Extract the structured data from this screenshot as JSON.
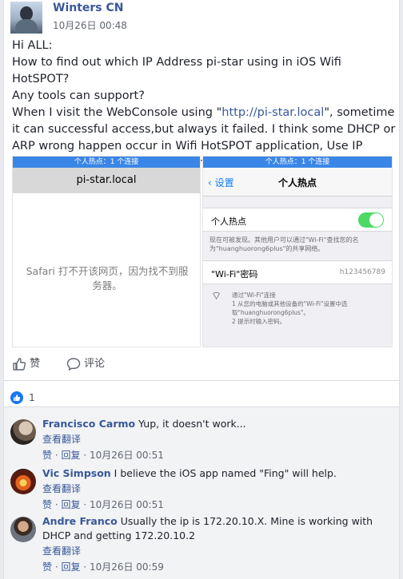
{
  "post": {
    "author": "Winters CN",
    "timestamp": "10月26日 00:48",
    "text_lines": [
      "Hi ALL:",
      "How to find out which IP Address pi-star using in iOS Wifi HotSPOT?",
      "Any tools can support?",
      "When I visit the WebConsole using \"",
      "http://pi-star.local",
      "\", sometime it can successful access,but always it failed. I think some DHCP or ARP wrong happen occur in Wifi HotSPOT application, Use IP Address to access will good methord."
    ]
  },
  "screenshot_left": {
    "hotspot_banner": "个人热点：1 个连接",
    "address": "pi-star.local",
    "error": "Safari 打不开该网页，因为找不到服务器。"
  },
  "screenshot_right": {
    "hotspot_banner": "个人热点：1 个连接",
    "back": "设置",
    "title": "个人热点",
    "toggle_label": "个人热点",
    "note": "现在可被发现。其他用户可以通过\"Wi-Fi\"查找您的名为\"huanghuorong6plus\"的共享网络。",
    "password_label": "\"Wi-Fi\"密码",
    "password_value": "h123456789",
    "wifi_help": "通过\"Wi-Fi\"连接\n1 从您的电脑或其他设备的\"Wi-Fi\"设置中选取\"huanghuorong6plus\"。\n2 提示时输入密码。"
  },
  "actions": {
    "like_label": "赞",
    "comment_label": "评论"
  },
  "reactions": {
    "like_count": "1"
  },
  "comments": [
    {
      "name": "Francisco Carmo",
      "text": "Yup, it doesn't work...",
      "translate": "查看翻译",
      "like": "赞",
      "reply": "回复",
      "time": "10月26日 00:51"
    },
    {
      "name": "Vic Simpson",
      "text": "I believe the iOS app named \"Fing\" will help.",
      "translate": "查看翻译",
      "like": "赞",
      "reply": "回复",
      "time": "10月26日 00:51"
    },
    {
      "name": "Andre Franco",
      "text": "Usually the ip is 172.20.10.X. Mine is working with DHCP and getting 172.20.10.2",
      "translate": "查看翻译",
      "like": "赞",
      "reply": "回复",
      "time": "10月26日 00:59"
    }
  ],
  "colors": {
    "link": "#385898",
    "accent": "#1877f2",
    "toggle_on": "#4cd964"
  }
}
